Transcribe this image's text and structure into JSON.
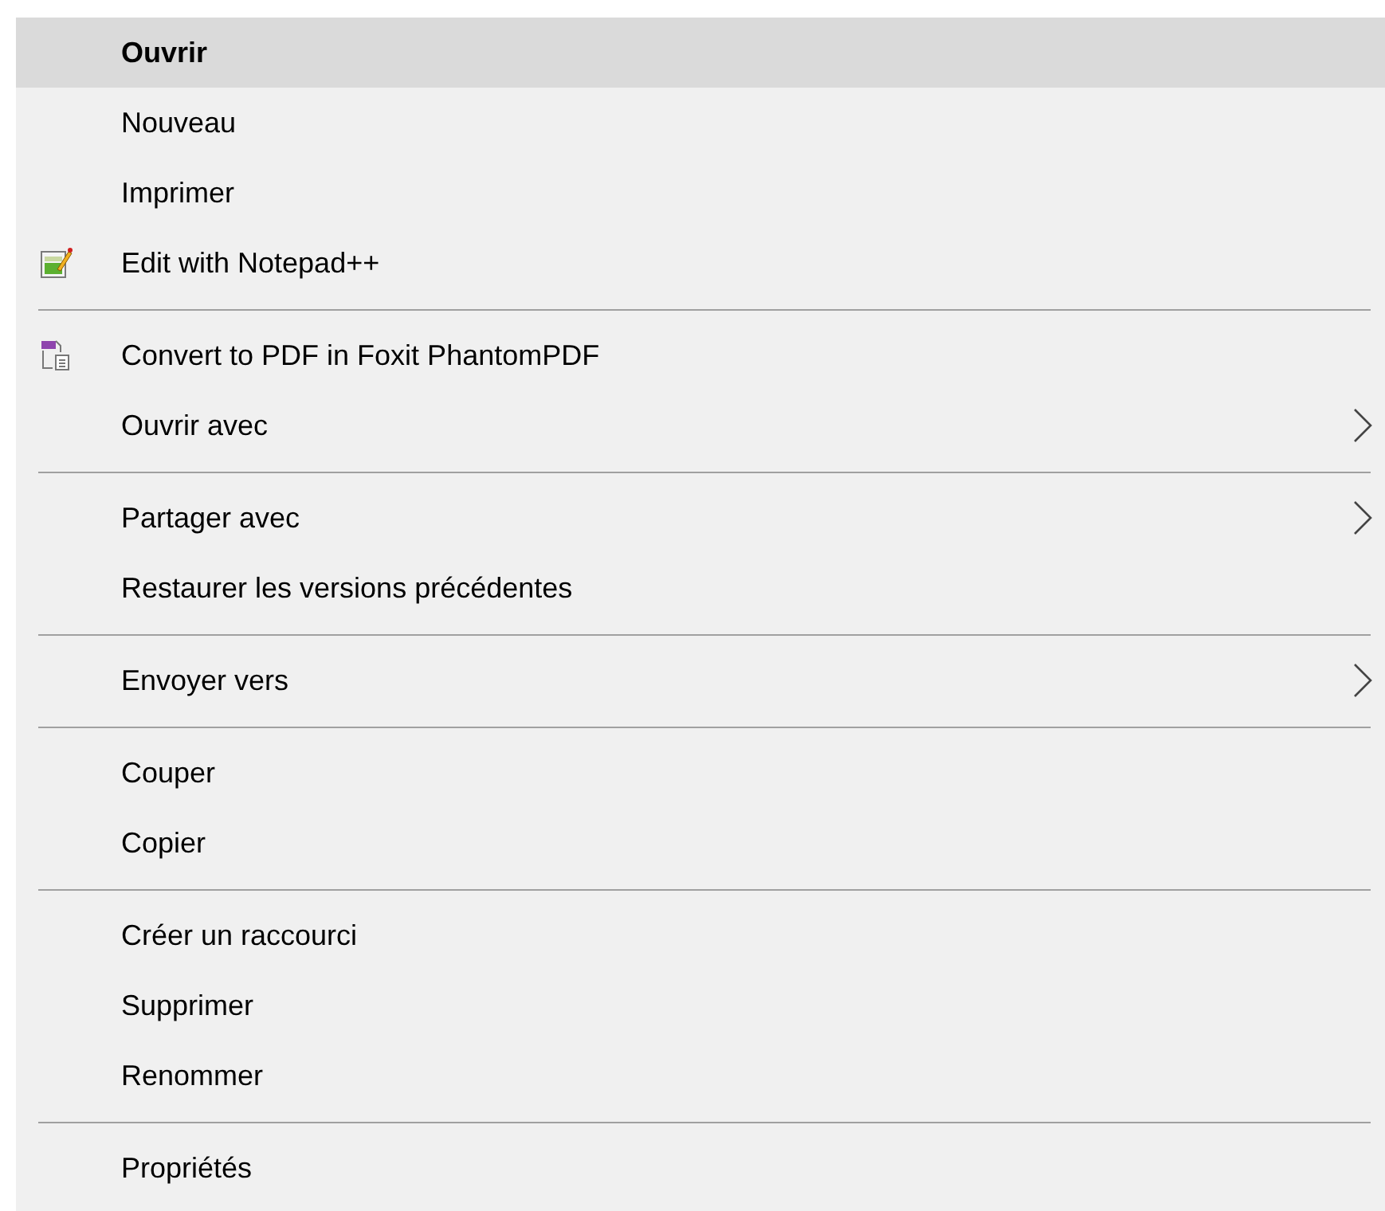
{
  "menu": {
    "groups": [
      {
        "items": [
          {
            "label": "Ouvrir",
            "selected": true,
            "bold": true,
            "kind": "plain",
            "submenu": false
          },
          {
            "label": "Nouveau",
            "selected": false,
            "bold": false,
            "kind": "plain",
            "submenu": false
          },
          {
            "label": "Imprimer",
            "selected": false,
            "bold": false,
            "kind": "plain",
            "submenu": false
          },
          {
            "label": "Edit with Notepad++",
            "selected": false,
            "bold": false,
            "kind": "notepad",
            "submenu": false
          }
        ]
      },
      {
        "items": [
          {
            "label": "Convert to PDF in Foxit PhantomPDF",
            "selected": false,
            "bold": false,
            "kind": "pdf",
            "submenu": false
          },
          {
            "label": "Ouvrir avec",
            "selected": false,
            "bold": false,
            "kind": "plain",
            "submenu": true
          }
        ]
      },
      {
        "items": [
          {
            "label": "Partager avec",
            "selected": false,
            "bold": false,
            "kind": "plain",
            "submenu": true
          },
          {
            "label": "Restaurer les versions précédentes",
            "selected": false,
            "bold": false,
            "kind": "plain",
            "submenu": false
          }
        ]
      },
      {
        "items": [
          {
            "label": "Envoyer vers",
            "selected": false,
            "bold": false,
            "kind": "plain",
            "submenu": true
          }
        ]
      },
      {
        "items": [
          {
            "label": "Couper",
            "selected": false,
            "bold": false,
            "kind": "plain",
            "submenu": false
          },
          {
            "label": "Copier",
            "selected": false,
            "bold": false,
            "kind": "plain",
            "submenu": false
          }
        ]
      },
      {
        "items": [
          {
            "label": "Créer un raccourci",
            "selected": false,
            "bold": false,
            "kind": "plain",
            "submenu": false
          },
          {
            "label": "Supprimer",
            "selected": false,
            "bold": false,
            "kind": "plain",
            "submenu": false
          },
          {
            "label": "Renommer",
            "selected": false,
            "bold": false,
            "kind": "plain",
            "submenu": false
          }
        ]
      },
      {
        "items": [
          {
            "label": "Propriétés",
            "selected": false,
            "bold": false,
            "kind": "plain",
            "submenu": false
          }
        ]
      }
    ]
  }
}
